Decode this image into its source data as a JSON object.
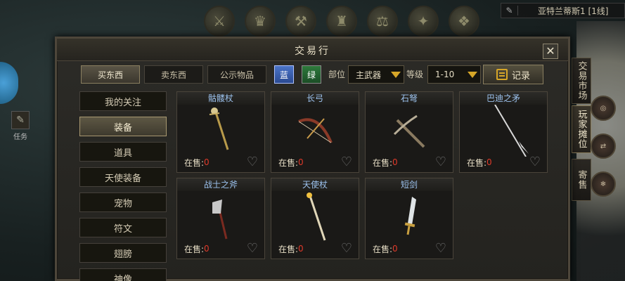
{
  "hud": {
    "location": "亚特兰蒂斯1 [1线]",
    "left_tool_label": "任务"
  },
  "panel": {
    "title": "交易行",
    "close_label": "✕",
    "tabs": [
      {
        "label": "买东西",
        "active": true
      },
      {
        "label": "卖东西",
        "active": false
      },
      {
        "label": "公示物品",
        "active": false
      }
    ],
    "quality_blue": "蓝",
    "quality_green": "绿",
    "slot_label": "部位",
    "slot_value": "主武器",
    "level_label": "等级",
    "level_value": "1-10",
    "record_label": "记录"
  },
  "categories": [
    {
      "label": "我的关注",
      "active": false
    },
    {
      "label": "装备",
      "active": true
    },
    {
      "label": "道具",
      "active": false
    },
    {
      "label": "天使装备",
      "active": false
    },
    {
      "label": "宠物",
      "active": false
    },
    {
      "label": "符文",
      "active": false
    },
    {
      "label": "翅膀",
      "active": false
    },
    {
      "label": "神像",
      "active": false
    }
  ],
  "items": [
    {
      "name": "骷髅杖",
      "on_sale_label": "在售:",
      "count": "0",
      "icon": "skull-staff-icon"
    },
    {
      "name": "长弓",
      "on_sale_label": "在售:",
      "count": "0",
      "icon": "longbow-icon"
    },
    {
      "name": "石弩",
      "on_sale_label": "在售:",
      "count": "0",
      "icon": "crossbow-icon"
    },
    {
      "name": "巴迪之矛",
      "on_sale_label": "在售:",
      "count": "0",
      "icon": "spear-icon"
    },
    {
      "name": "战士之斧",
      "on_sale_label": "在售:",
      "count": "0",
      "icon": "axe-icon"
    },
    {
      "name": "天使杖",
      "on_sale_label": "在售:",
      "count": "0",
      "icon": "angel-staff-icon"
    },
    {
      "name": "短剑",
      "on_sale_label": "在售:",
      "count": "0",
      "icon": "short-sword-icon"
    }
  ],
  "side_tabs": [
    {
      "label": "交易市场",
      "active": false
    },
    {
      "label": "玩家摊位",
      "active": true
    },
    {
      "label": "寄售",
      "active": false
    }
  ],
  "colors": {
    "item_name": "#9cc2ee",
    "count": "#e03a2a",
    "accent": "#d6a628"
  }
}
